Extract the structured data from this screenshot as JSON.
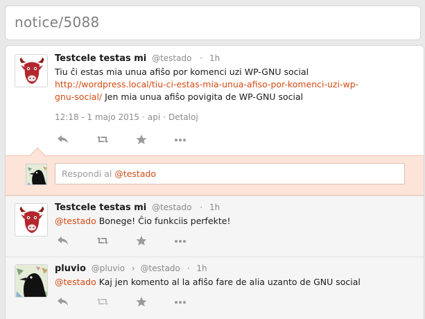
{
  "page": {
    "title": "notice/5088"
  },
  "colors": {
    "link": "#d24b13",
    "reply_bg": "#fde4d9",
    "muted": "#8a8a8a"
  },
  "main_notice": {
    "author": "Testcele testas mi",
    "nickname": "@testado",
    "age": "1h",
    "text_before": "Tiu ĉi estas mia unua afiŝo por komenci uzi WP-GNU social ",
    "link": "http://wordpress.local/tiu-ci-estas-mia-unua-afiso-por-komenci-uzi-wp-gnu-social/",
    "link_line1": "http://wordpress.local/tiu-ci-estas-mia-unua-afiso-por-komenci-uzi-wp-",
    "link_line2": "gnu-social/",
    "text_after": " Jen mia unua afiŝo povigita de WP-GNU social",
    "timestamp": "12:18 - 1 majo 2015",
    "source": "api",
    "details": "Detaloj",
    "avatar_icon": "red-bull-avatar-icon"
  },
  "reply_form": {
    "prefix": "Respondi al ",
    "mention": "@testado"
  },
  "replies": [
    {
      "author": "Testcele testas mi",
      "nickname": "@testado",
      "age": "1h",
      "mention": "@testado",
      "text": " Bonege! Ĉio funkciis perfekte!",
      "avatar_icon": "red-bull-avatar-icon"
    },
    {
      "author": "pluvio",
      "nickname": "@pluvio",
      "arrow": "›",
      "to": "@testado",
      "age": "1h",
      "mention": "@testado",
      "text": " Kaj jen komento al la afiŝo fare de alia uzanto de GNU social",
      "avatar_icon": "black-bird-avatar-icon"
    }
  ],
  "icons": [
    "reply-icon",
    "repeat-icon",
    "favorite-icon",
    "more-icon"
  ]
}
